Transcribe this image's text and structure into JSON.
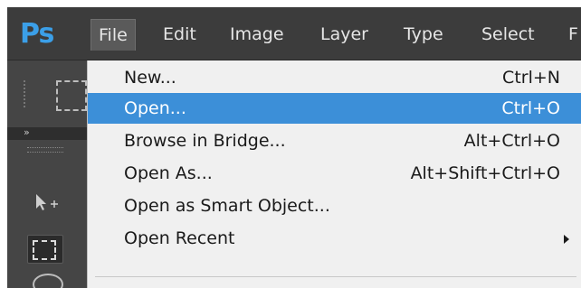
{
  "app": {
    "logo": "Ps"
  },
  "menubar": {
    "items": [
      "File",
      "Edit",
      "Image",
      "Layer",
      "Type",
      "Select",
      "F"
    ],
    "active": "File"
  },
  "file_menu": {
    "items": [
      {
        "label": "New...",
        "shortcut": "Ctrl+N"
      },
      {
        "label": "Open...",
        "shortcut": "Ctrl+O"
      },
      {
        "label": "Browse in Bridge...",
        "shortcut": "Alt+Ctrl+O"
      },
      {
        "label": "Open As...",
        "shortcut": "Alt+Shift+Ctrl+O"
      },
      {
        "label": "Open as Smart Object...",
        "shortcut": ""
      },
      {
        "label": "Open Recent",
        "shortcut": ""
      }
    ],
    "highlighted": "Open...",
    "submenu_item": "Open Recent"
  },
  "toolbar": {
    "collapse_glyph": "»",
    "tools": [
      "marquee-icon",
      "move-icon",
      "rectangular-marquee-icon",
      "lasso-icon"
    ]
  },
  "colors": {
    "highlight": "#3c8fd8",
    "ps_logo": "#3b9fe8",
    "menubar_bg": "#3c3c3c",
    "menu_bg": "#f0f0f0"
  }
}
